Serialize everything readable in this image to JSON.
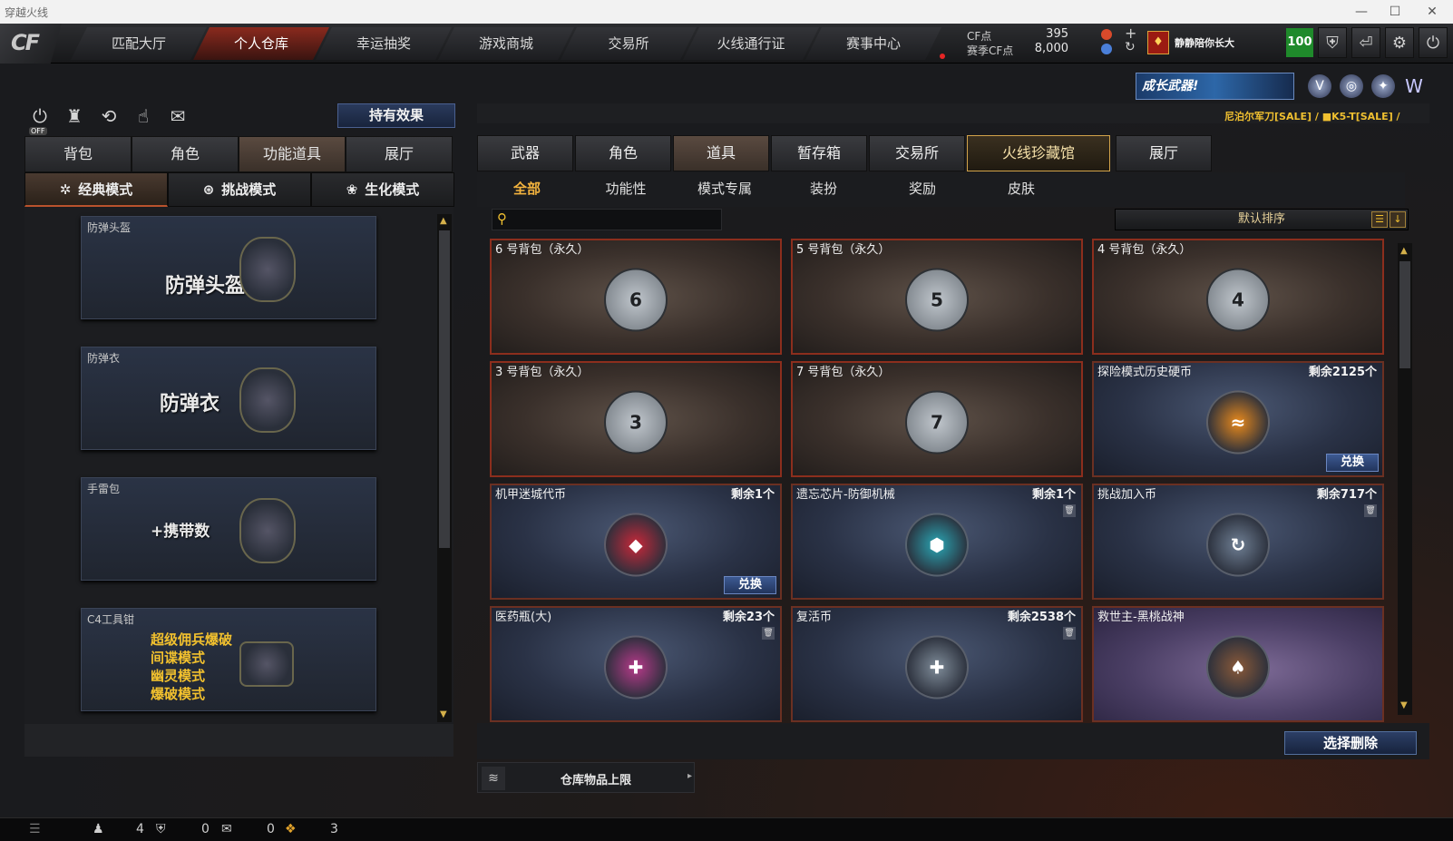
{
  "window": {
    "title": "穿越火线",
    "controls": [
      "—",
      "☐",
      "✕"
    ]
  },
  "nav": {
    "logo": "CF",
    "tabs": [
      {
        "label": "匹配大厅",
        "active": false
      },
      {
        "label": "个人仓库",
        "active": true
      },
      {
        "label": "幸运抽奖",
        "active": false
      },
      {
        "label": "游戏商城",
        "active": false
      },
      {
        "label": "交易所",
        "active": false
      },
      {
        "label": "火线通行证",
        "active": false
      },
      {
        "label": "赛事中心",
        "active": false
      }
    ]
  },
  "currency": {
    "cf_label": "CF点",
    "cf_value": "395",
    "season_label": "赛季CF点",
    "season_value": "8,000",
    "plus": "+",
    "refresh": "↻"
  },
  "player": {
    "rank_icon": "♦",
    "name": "静静陪你长大",
    "level": "100"
  },
  "header_icons": [
    "shield-icon",
    "exit-icon",
    "gear-icon",
    "power-icon"
  ],
  "header_icon_glyphs": [
    "⛨",
    "⏎",
    "⚙",
    "⏻"
  ],
  "quick_icons": [
    {
      "name": "toggle-off-icon",
      "glyph": "⏻",
      "badge": "OFF"
    },
    {
      "name": "podium-icon",
      "glyph": "♜"
    },
    {
      "name": "history-icon",
      "glyph": "⟲"
    },
    {
      "name": "hand-icon",
      "glyph": "☝"
    },
    {
      "name": "mouse-icon",
      "glyph": "✉"
    }
  ],
  "effect_button": "持有效果",
  "left_tabs": [
    {
      "label": "背包",
      "active": false
    },
    {
      "label": "角色",
      "active": false
    },
    {
      "label": "功能道具",
      "active": true
    },
    {
      "label": "展厅",
      "active": false
    }
  ],
  "mode_tabs": [
    {
      "label": "经典模式",
      "icon": "✲",
      "active": true
    },
    {
      "label": "挑战模式",
      "icon": "⊛",
      "active": false
    },
    {
      "label": "生化模式",
      "icon": "❀",
      "active": false
    }
  ],
  "left_cards": [
    {
      "title": "防弹头盔",
      "big": "防弹头盔",
      "lines": []
    },
    {
      "title": "防弹衣",
      "big": "防弹衣",
      "lines": []
    },
    {
      "title": "手雷包",
      "big": "+携带数",
      "lines": []
    },
    {
      "title": "C4工具钳",
      "big": "",
      "lines": [
        "超级佣兵爆破",
        "间谍模式",
        "幽灵模式",
        "爆破模式"
      ]
    }
  ],
  "banner": {
    "text": "成长武器!",
    "sale_text": "尼泊尔军刀[SALE] / ■K5-T[SALE] /"
  },
  "right_tabs": [
    {
      "label": "武器",
      "active": false,
      "special": false
    },
    {
      "label": "角色",
      "active": false,
      "special": false
    },
    {
      "label": "道具",
      "active": true,
      "special": false
    },
    {
      "label": "暂存箱",
      "active": false,
      "special": false
    },
    {
      "label": "交易所",
      "active": false,
      "special": false
    },
    {
      "label": "火线珍藏馆",
      "active": false,
      "special": true
    },
    {
      "label": "展厅",
      "active": false,
      "special": false
    }
  ],
  "sub_tabs": [
    {
      "label": "全部",
      "active": true
    },
    {
      "label": "功能性",
      "active": false
    },
    {
      "label": "模式专属",
      "active": false
    },
    {
      "label": "装扮",
      "active": false
    },
    {
      "label": "奖励",
      "active": false
    },
    {
      "label": "皮肤",
      "active": false
    }
  ],
  "search": {
    "placeholder": ""
  },
  "sort": {
    "label": "默认排序"
  },
  "items": [
    {
      "name": "6 号背包（永久）",
      "count": "",
      "style": "bag",
      "glyph": "6",
      "redeem": "",
      "trash": false
    },
    {
      "name": "5 号背包（永久）",
      "count": "",
      "style": "bag",
      "glyph": "5",
      "redeem": "",
      "trash": false
    },
    {
      "name": "4 号背包（永久）",
      "count": "",
      "style": "bag",
      "glyph": "4",
      "redeem": "",
      "trash": false
    },
    {
      "name": "3 号背包（永久）",
      "count": "",
      "style": "bag",
      "glyph": "3",
      "redeem": "",
      "trash": false
    },
    {
      "name": "7 号背包（永久）",
      "count": "",
      "style": "bag",
      "glyph": "7",
      "redeem": "",
      "trash": false
    },
    {
      "name": "探险模式历史硬币",
      "count": "剩余2125个",
      "style": "blue",
      "glyph": "≈",
      "color": "#e8891c",
      "redeem": "兑换",
      "trash": false
    },
    {
      "name": "机甲迷城代币",
      "count": "剩余1个",
      "style": "blue",
      "glyph": "◆",
      "color": "#c8283a",
      "redeem": "兑换",
      "trash": false
    },
    {
      "name": "遗忘芯片-防御机械",
      "count": "剩余1个",
      "style": "blue",
      "glyph": "⬢",
      "color": "#2aa7b5",
      "redeem": "",
      "trash": true
    },
    {
      "name": "挑战加入币",
      "count": "剩余717个",
      "style": "blue",
      "glyph": "↻",
      "color": "#6f7f94",
      "redeem": "",
      "trash": true
    },
    {
      "name": "医药瓶(大)",
      "count": "剩余23个",
      "style": "blue",
      "glyph": "✚",
      "color": "#b73a8a",
      "redeem": "",
      "trash": true
    },
    {
      "name": "复活币",
      "count": "剩余2538个",
      "style": "blue",
      "glyph": "✚",
      "color": "#7f8c99",
      "redeem": "",
      "trash": true
    },
    {
      "name": "救世主-黑桃战神",
      "count": "",
      "style": "purple",
      "glyph": "♠",
      "color": "#8a5a3a",
      "redeem": "",
      "trash": false
    }
  ],
  "delete_button": "选择删除",
  "capacity": {
    "label": "仓库物品上限",
    "icon": "≋",
    "arrow": "▸"
  },
  "status": {
    "friends": "4",
    "messages": "0",
    "chat": "0",
    "gifts": "3"
  }
}
